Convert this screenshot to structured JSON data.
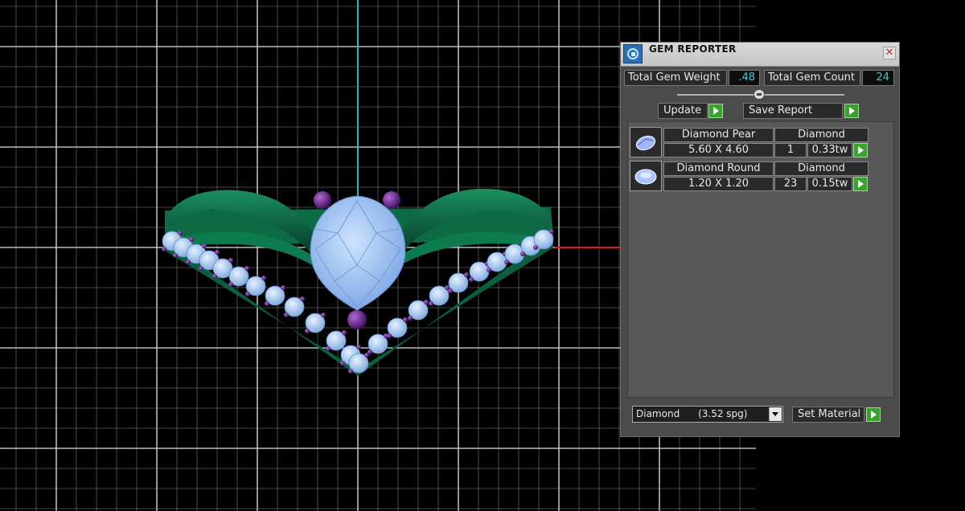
{
  "viewport": {
    "colors": {
      "background": "#000000",
      "grid": "#cfcfcf",
      "axis_y": "#2bb5c0",
      "axis_x": "#e01818",
      "band": "#0f6b46",
      "stone": "#9ec6f4",
      "prong": "#6a1f8f"
    }
  },
  "panel": {
    "title": "GEM REPORTER",
    "close_icon": "close-icon",
    "app_icon": "gem-reporter-icon",
    "total_weight": {
      "label": "Total Gem Weight",
      "value": ".48"
    },
    "total_count": {
      "label": "Total Gem Count",
      "value": "24"
    },
    "update_label": "Update",
    "save_report_label": "Save Report",
    "gems": [
      {
        "name": "Diamond Pear",
        "material": "Diamond",
        "size": "5.60 X 4.60",
        "count": "1",
        "weight": "0.33tw",
        "icon": "pear-gem-icon"
      },
      {
        "name": "Diamond Round",
        "material": "Diamond",
        "size": "1.20 X 1.20",
        "count": "23",
        "weight": "0.15tw",
        "icon": "round-gem-icon"
      }
    ],
    "material_select": {
      "value": "Diamond      (3.52 spg)"
    },
    "set_material_label": "Set Material"
  }
}
